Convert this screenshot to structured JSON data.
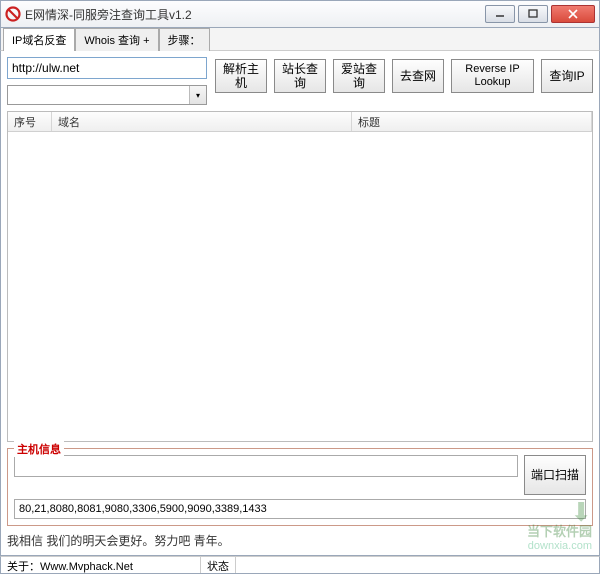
{
  "window": {
    "title": "E网情深-同服旁注查询工具v1.2"
  },
  "tabs": {
    "t1": "IP域名反查",
    "t2": "Whois 查询 +",
    "t3": "步骤："
  },
  "inputs": {
    "url_value": "http://ulw.net",
    "combo_value": "",
    "ports_value": "80,21,8080,8081,9080,3306,5900,9090,3389,1433"
  },
  "buttons": {
    "parse_host": "解析主机",
    "chinaz": "站长查询",
    "aizhan": "爱站查询",
    "quchawang": "去查网",
    "reverse_ip": "Reverse IP Lookup",
    "query_ip": "查询IP",
    "port_scan": "端口扫描"
  },
  "listview": {
    "col1": "序号",
    "col2": "域名",
    "col3": "标题"
  },
  "groupbox": {
    "legend": "主机信息"
  },
  "message": "我相信 我们的明天会更好。努力吧 青年。",
  "statusbar": {
    "about": "关于：Www.Mvphack.Net",
    "status": "状态"
  },
  "watermark": {
    "line1": "当下软件园",
    "line2": "downxia.com"
  }
}
